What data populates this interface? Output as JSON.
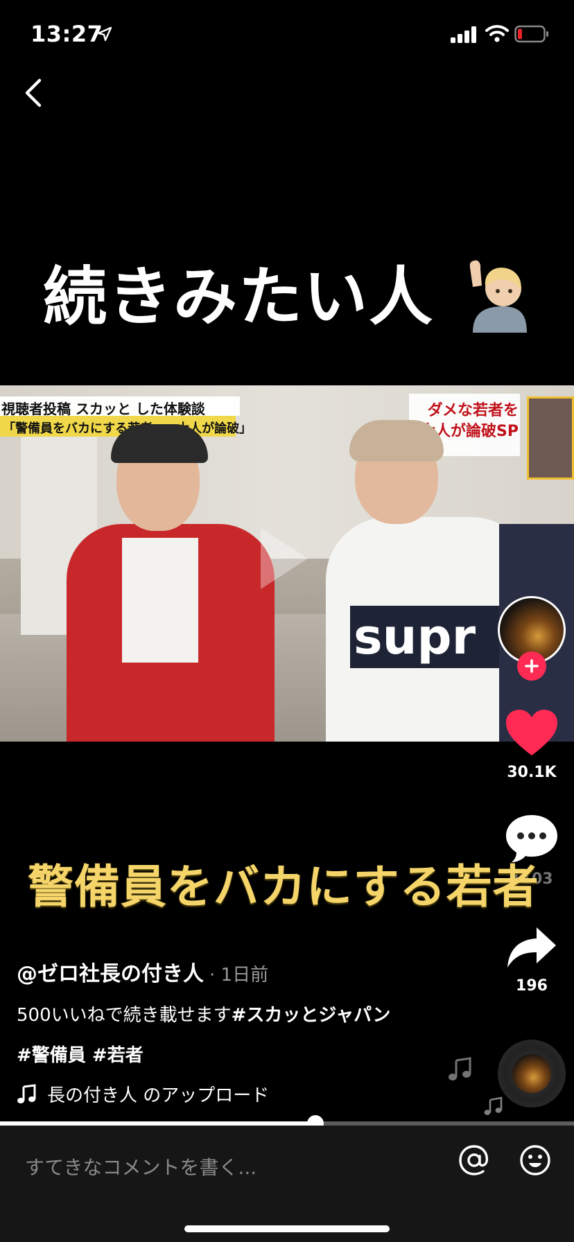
{
  "status_bar": {
    "time": "13:27",
    "icons": [
      "location-arrow-icon",
      "cellular-signal-icon",
      "wifi-icon",
      "battery-low-icon"
    ],
    "battery_color": "#e8242a"
  },
  "video": {
    "title_text": "続きみたい人",
    "title_emoji": "raising-hand-icon",
    "subtitle_text": "警備員をバカにする若者",
    "subtitle_color": "#f5d56a",
    "banner_line_1": "視聴者投稿 スカッと した体験談",
    "banner_line_2": "「警備員をバカにする若者 vs 大人が論破」",
    "corner_line_1": "ダメな若者を",
    "corner_line_2": "大人が論破SP",
    "shirt_text": "supr"
  },
  "actions": {
    "like_count": "30.1K",
    "comment_count": "1103",
    "share_count": "196",
    "like_color": "#ff2b55"
  },
  "post": {
    "author": "@ゼロ社長の付き人",
    "time": "· 1日前",
    "description": "500いいねで続き載せます",
    "description_tag": "#スカッとジャパン",
    "hashtags": "#警備員 #若者",
    "music": "長の付き人 のアップロード"
  },
  "player": {
    "progress_fraction": 0.55
  },
  "comment_bar": {
    "placeholder": "すてきなコメントを書く..."
  }
}
